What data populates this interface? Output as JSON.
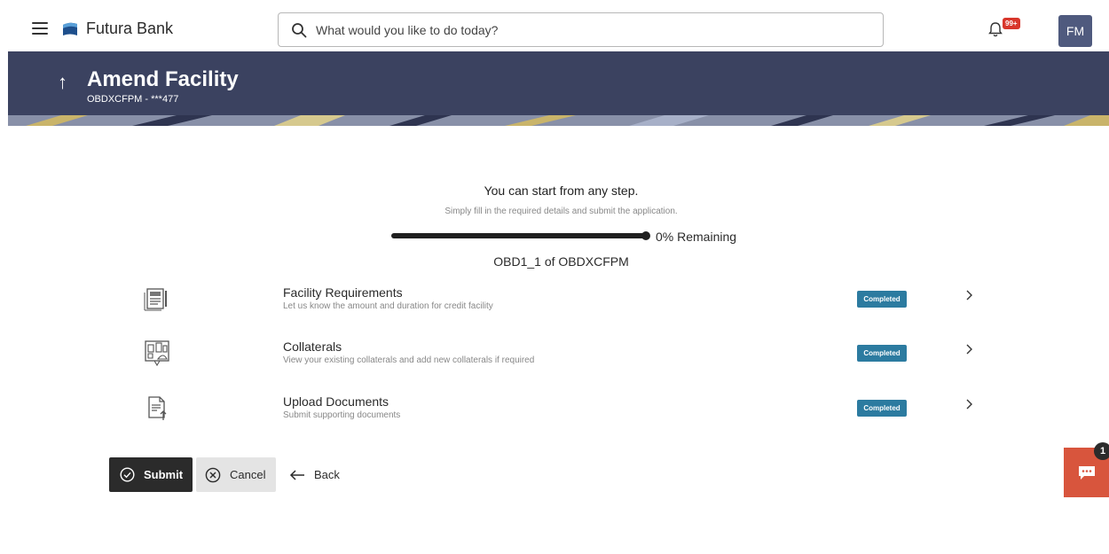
{
  "header": {
    "brand": "Futura Bank",
    "search_placeholder": "What would you like to do today?",
    "notification_badge": "99+",
    "user_initials": "FM",
    "icons": [
      "menu-icon",
      "bank-logo-icon",
      "search-icon",
      "bell-icon"
    ]
  },
  "banner": {
    "title": "Amend Facility",
    "subtitle": "OBDXCFPM - ***477",
    "color": "#3b4260"
  },
  "intro": {
    "title": "You can start from any step.",
    "subtitle": "Simply fill in the required details and submit the application."
  },
  "progress": {
    "remaining_percent": 0,
    "label": "0% Remaining"
  },
  "application_id": "OBD1_1 of OBDXCFPM",
  "steps": [
    {
      "title": "Facility Requirements",
      "description": "Let us know the amount and duration for credit facility",
      "status": "Completed",
      "icon": "document-form-icon"
    },
    {
      "title": "Collaterals",
      "description": "View your existing collaterals and add new collaterals if required",
      "status": "Completed",
      "icon": "property-collateral-icon"
    },
    {
      "title": "Upload Documents",
      "description": "Submit supporting documents",
      "status": "Completed",
      "icon": "document-upload-icon"
    }
  ],
  "actions": {
    "submit": "Submit",
    "cancel": "Cancel",
    "back": "Back"
  },
  "chat": {
    "count": "1",
    "color": "#d8553d"
  },
  "colors": {
    "status_completed": "#2c7ba0",
    "primary_button": "#2b2b2b",
    "avatar": "#4f5a7e"
  }
}
